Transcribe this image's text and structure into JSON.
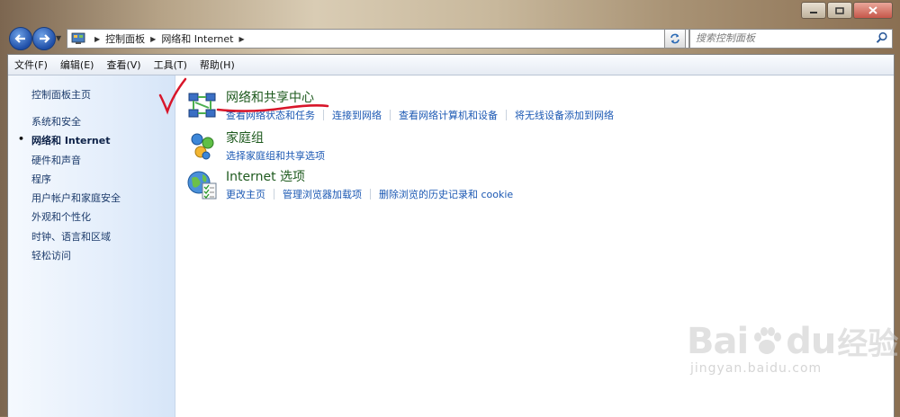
{
  "address_bar": {
    "breadcrumb": [
      "控制面板",
      "网络和 Internet"
    ]
  },
  "search": {
    "placeholder": "搜索控制面板"
  },
  "menu": [
    "文件(F)",
    "编辑(E)",
    "查看(V)",
    "工具(T)",
    "帮助(H)"
  ],
  "sidebar": {
    "home": "控制面板主页",
    "items": [
      {
        "label": "系统和安全",
        "active": false
      },
      {
        "label": "网络和 Internet",
        "active": true
      },
      {
        "label": "硬件和声音",
        "active": false
      },
      {
        "label": "程序",
        "active": false
      },
      {
        "label": "用户帐户和家庭安全",
        "active": false
      },
      {
        "label": "外观和个性化",
        "active": false
      },
      {
        "label": "时钟、语言和区域",
        "active": false
      },
      {
        "label": "轻松访问",
        "active": false
      }
    ],
    "bullet": "•"
  },
  "sections": [
    {
      "title": "网络和共享中心",
      "icon": "network-center-icon",
      "links": [
        "查看网络状态和任务",
        "连接到网络",
        "查看网络计算机和设备",
        "将无线设备添加到网络"
      ]
    },
    {
      "title": "家庭组",
      "icon": "homegroup-icon",
      "links": [
        "选择家庭组和共享选项"
      ]
    },
    {
      "title": "Internet 选项",
      "icon": "internet-options-icon",
      "links": [
        "更改主页",
        "管理浏览器加载项",
        "删除浏览的历史记录和 cookie"
      ]
    }
  ],
  "watermark": {
    "brand_left": "Bai",
    "brand_right": "du",
    "brand_cn": "经验",
    "url": "jingyan.baidu.com"
  },
  "colors": {
    "link": "#1b58b3",
    "section_title": "#1e5a1e",
    "annotation": "#d8162a"
  }
}
